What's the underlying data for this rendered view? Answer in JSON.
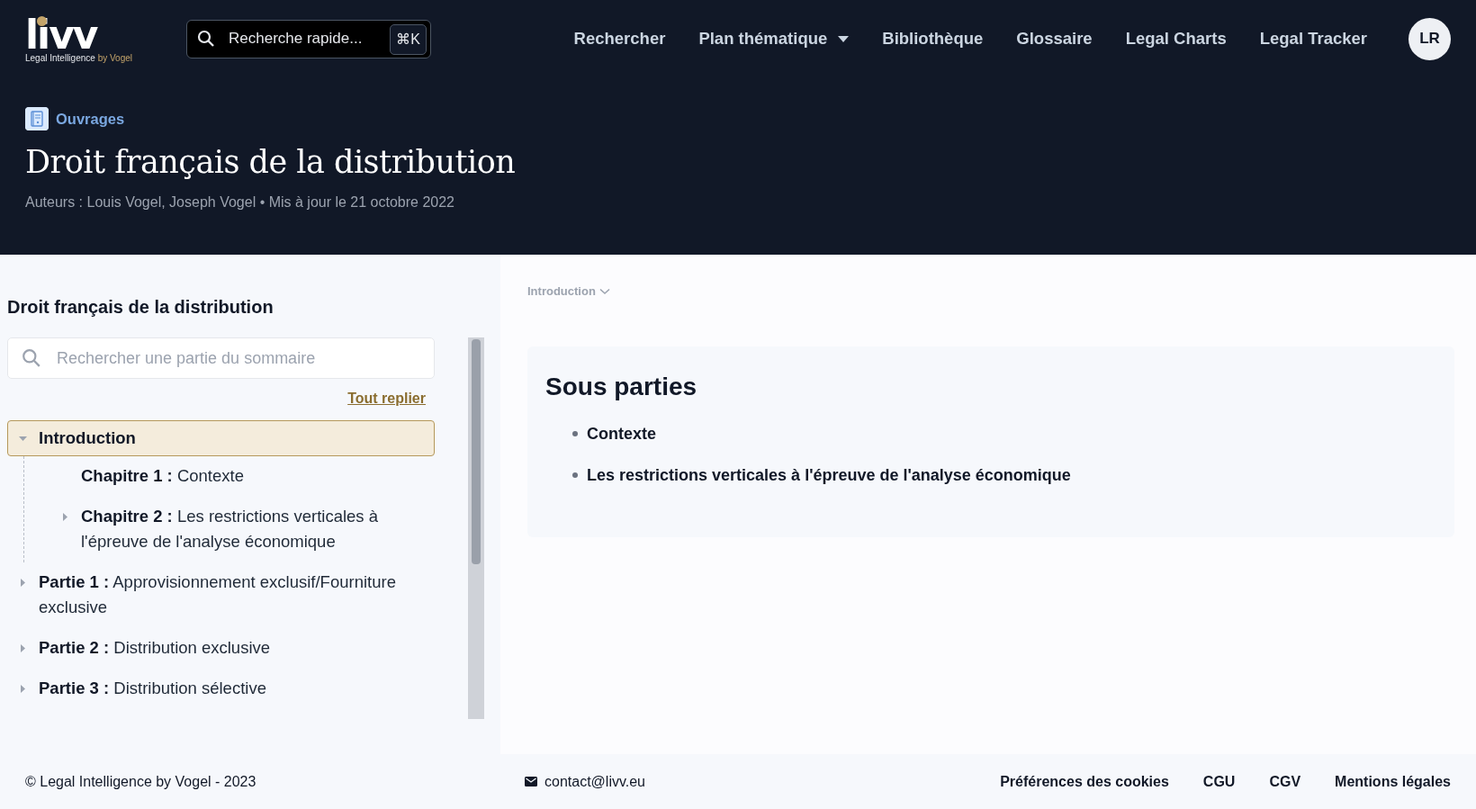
{
  "header": {
    "logo": {
      "wordmark": "livv",
      "tagline": "Legal Intelligence",
      "tagline_suffix": "by Vogel"
    },
    "search": {
      "placeholder": "Recherche rapide...",
      "shortcut": "⌘K"
    },
    "nav": [
      {
        "label": "Rechercher",
        "kind": "link"
      },
      {
        "label": "Plan thématique",
        "kind": "dropdown"
      },
      {
        "label": "Bibliothèque",
        "kind": "link"
      },
      {
        "label": "Glossaire",
        "kind": "link"
      },
      {
        "label": "Legal Charts",
        "kind": "link"
      },
      {
        "label": "Legal Tracker",
        "kind": "link"
      }
    ],
    "avatar": "LR"
  },
  "hero": {
    "category": "Ouvrages",
    "title": "Droit français de la distribution",
    "meta": "Auteurs : Louis Vogel, Joseph Vogel • Mis à jour le 21 octobre 2022"
  },
  "sidebar": {
    "title": "Droit français de la distribution",
    "search": {
      "placeholder": "Rechercher une partie du sommaire"
    },
    "collapse_all": "Tout replier",
    "tree": [
      {
        "title": "Introduction",
        "kind": "branch",
        "expanded": true,
        "selected": true,
        "children": [
          {
            "prefix": "Chapitre 1 :",
            "title": "Contexte",
            "kind": "leaf",
            "selected": false
          },
          {
            "prefix": "Chapitre 2 :",
            "title": "Les restrictions verticales à l'épreuve de l'analyse économique",
            "kind": "branch",
            "expanded": false,
            "selected": false
          }
        ]
      },
      {
        "prefix": "Partie 1 :",
        "title": "Approvisionnement exclusif/Fourniture exclusive",
        "kind": "branch",
        "expanded": false,
        "selected": false
      },
      {
        "prefix": "Partie 2 :",
        "title": "Distribution exclusive",
        "kind": "branch",
        "expanded": false,
        "selected": false
      },
      {
        "prefix": "Partie 3 :",
        "title": "Distribution sélective",
        "kind": "branch",
        "expanded": false,
        "selected": false
      }
    ]
  },
  "content": {
    "breadcrumb": "Introduction",
    "section_title": "Sous parties",
    "items": [
      "Contexte",
      "Les restrictions verticales à l'épreuve de l'analyse économique"
    ]
  },
  "footer": {
    "copyright": "© Legal Intelligence by Vogel - 2023",
    "email": "contact@livv.eu",
    "links": [
      "Préférences des cookies",
      "CGU",
      "CGV",
      "Mentions légales"
    ]
  }
}
